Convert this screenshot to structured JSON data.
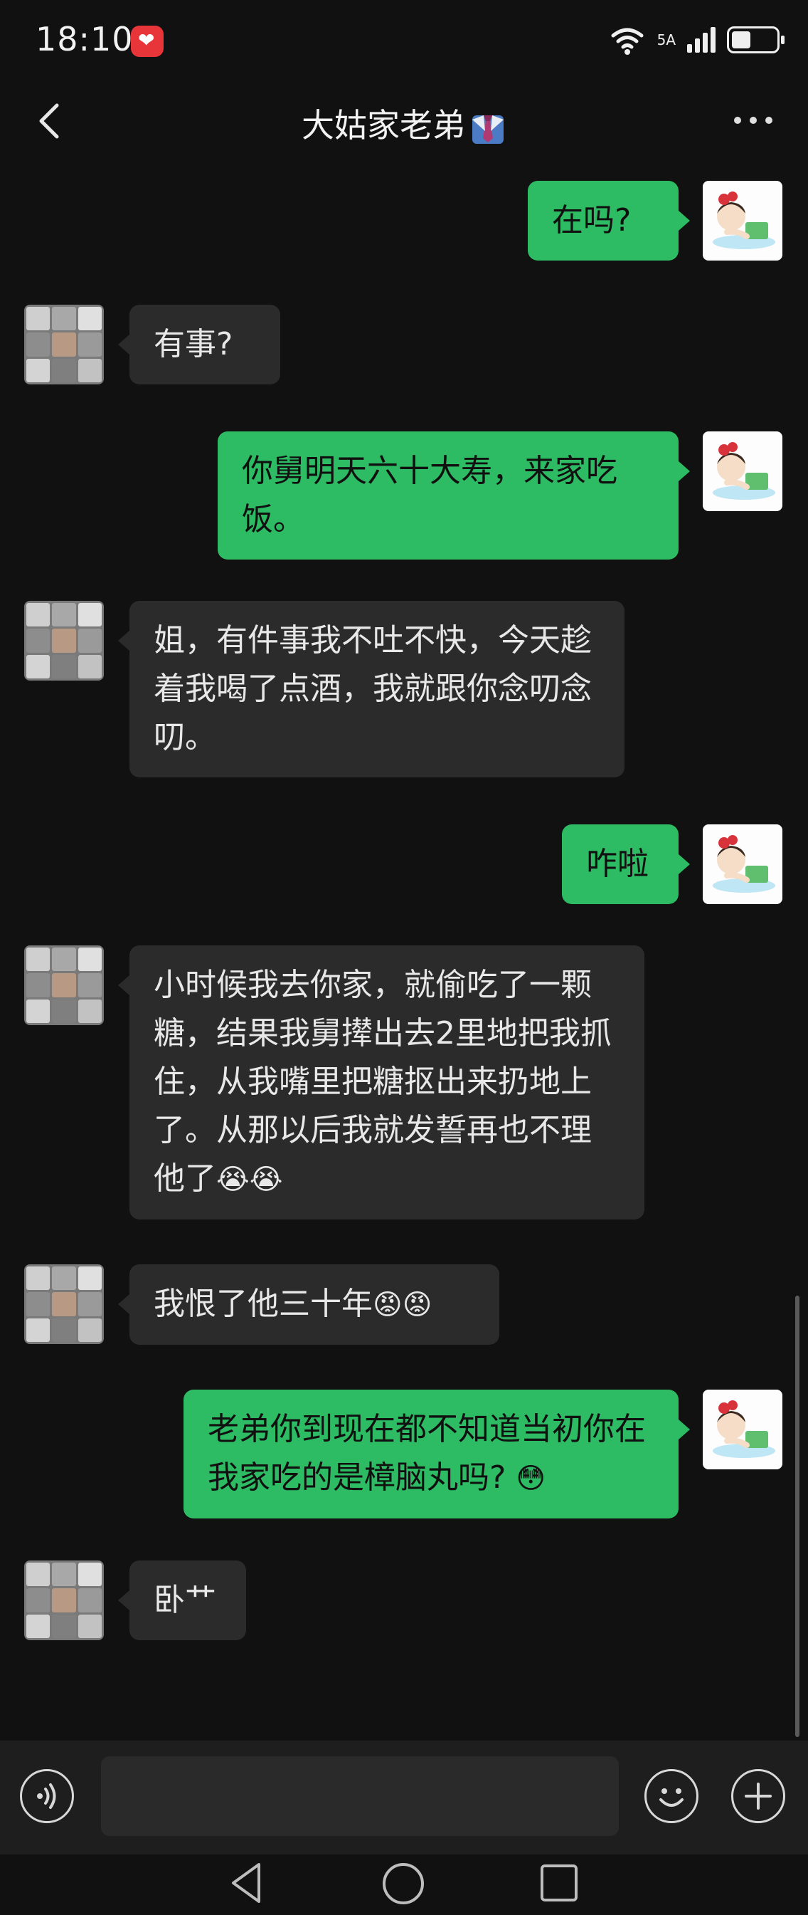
{
  "status_bar": {
    "time": "18:10",
    "network_label": "5A",
    "wifi_label": "6"
  },
  "header": {
    "title": "大姑家老弟"
  },
  "messages": [
    {
      "side": "out",
      "text": "在吗?"
    },
    {
      "side": "in",
      "text": "有事?"
    },
    {
      "side": "out",
      "text": "你舅明天六十大寿，来家吃饭。"
    },
    {
      "side": "in",
      "text": "姐，有件事我不吐不快，今天趁着我喝了点酒，我就跟你念叨念叨。"
    },
    {
      "side": "out",
      "text": "咋啦"
    },
    {
      "side": "in",
      "text": "小时候我去你家，就偷吃了一颗糖，结果我舅撵出去2里地把我抓住，从我嘴里把糖抠出来扔地上了。从那以后我就发誓再也不理他了",
      "emoji": "😭😭"
    },
    {
      "side": "in",
      "text": "我恨了他三十年",
      "emoji": "😡😡"
    },
    {
      "side": "out",
      "text": "老弟你到现在都不知道当初你在我家吃的是樟脑丸吗? ",
      "emoji": "😳"
    },
    {
      "side": "in",
      "text": "卧艹"
    }
  ],
  "input_bar": {
    "placeholder": ""
  },
  "colors": {
    "outgoing_bubble": "#2dbb63",
    "incoming_bubble": "#2b2b2b",
    "background": "#111111"
  },
  "icons": {
    "back": "chevron-left-icon",
    "more": "more-dots-icon",
    "voice": "voice-icon",
    "emoji": "smiley-icon",
    "plus": "plus-icon",
    "tie": "tie-icon"
  }
}
